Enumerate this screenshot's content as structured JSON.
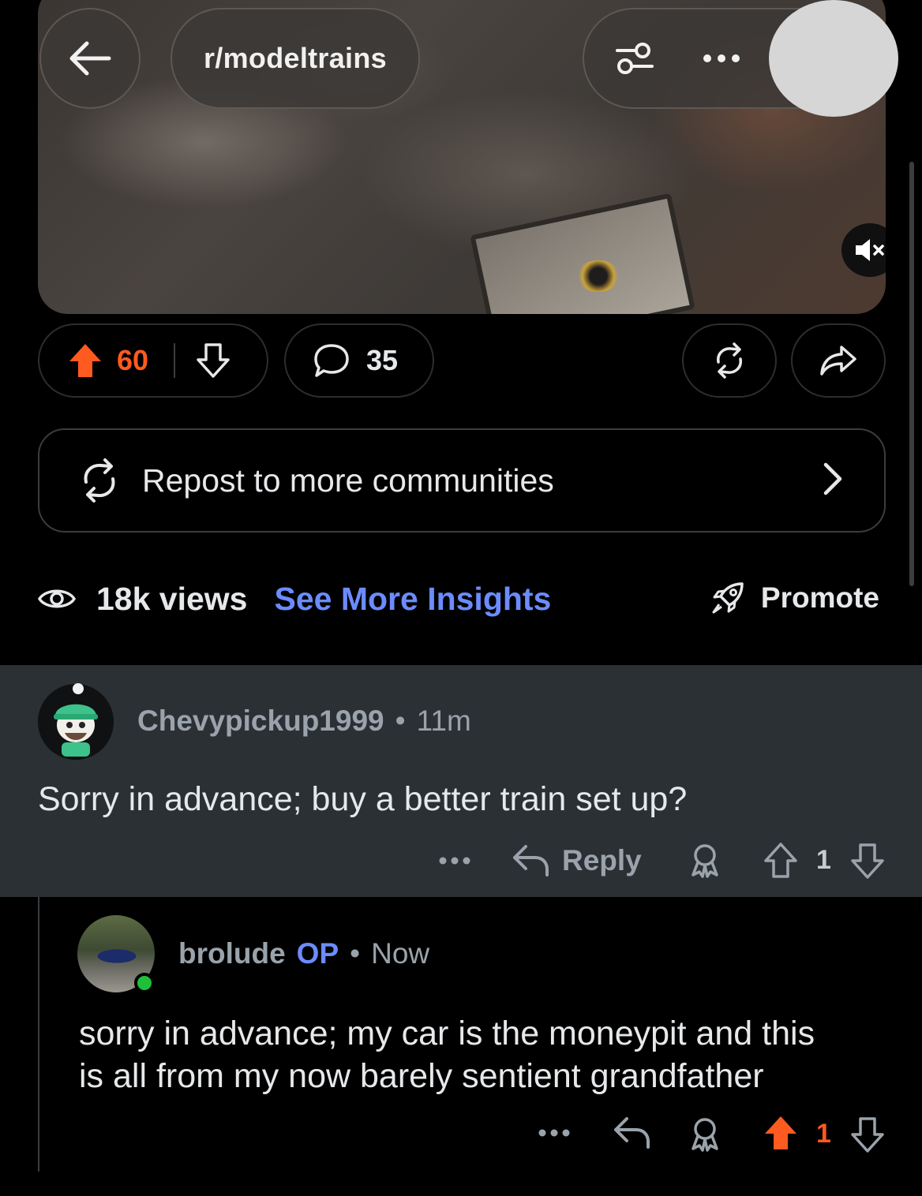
{
  "header": {
    "subreddit": "r/modeltrains"
  },
  "post_actions": {
    "upvotes": "60",
    "comments": "35",
    "upvote_state": "upvoted"
  },
  "repost_banner": {
    "label": "Repost to more communities"
  },
  "stats": {
    "views": "18k views",
    "insights": "See More Insights",
    "promote": "Promote"
  },
  "comments": [
    {
      "username": "Chevypickup1999",
      "separator": "•",
      "time": "11m",
      "body": "Sorry in advance; buy a better train set up?",
      "reply_label": "Reply",
      "score": "1",
      "vote_state": "none"
    },
    {
      "username": "brolude",
      "badge": "OP",
      "separator": "•",
      "time": "Now",
      "body_lines": [
        "sorry in advance; my car is the moneypit and this",
        "is all from my now barely sentient grandfather"
      ],
      "score": "1",
      "vote_state": "upvoted",
      "online": true
    }
  ],
  "colors": {
    "accent_blue": "#6b8cff",
    "upvote_orange": "#ff5a1f",
    "comment_highlight_bg": "#2b3034",
    "online_green": "#1fbf3a"
  }
}
